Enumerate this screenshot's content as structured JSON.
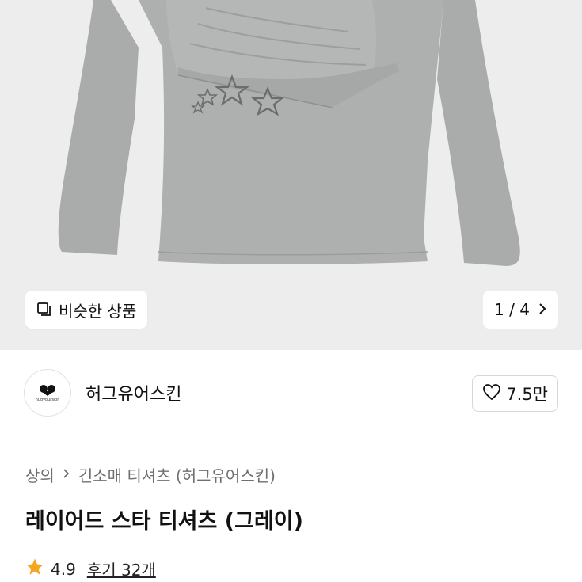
{
  "hero": {
    "similar_label": "비슷한 상품",
    "pager_current": "1",
    "pager_sep": "/",
    "pager_total": "4"
  },
  "shop": {
    "avatar_text": "hugyourskin",
    "name": "허그유어스킨",
    "like_count": "7.5만"
  },
  "breadcrumb": {
    "root": "상의",
    "category": "긴소매 티셔츠 (허그유어스킨)"
  },
  "product": {
    "title": "레이어드 스타 티셔츠 (그레이)",
    "rating": "4.9",
    "reviews_label": "후기 32개"
  },
  "colors": {
    "hero_bg": "#ededed",
    "star": "#f5a623"
  }
}
